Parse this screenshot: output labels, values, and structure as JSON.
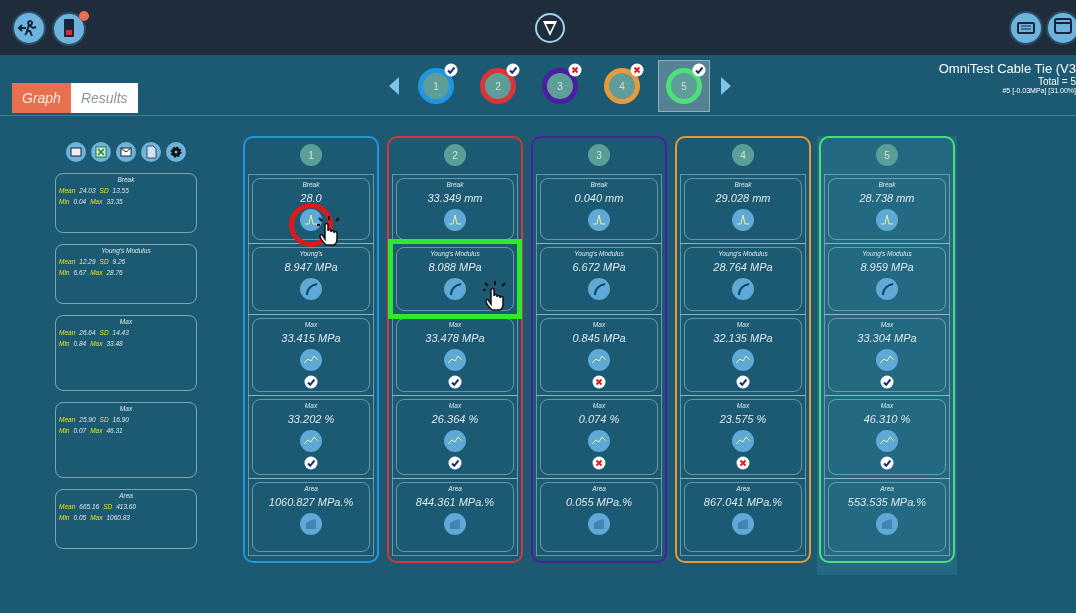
{
  "tabs": [
    {
      "label": "Graph",
      "selected": true
    },
    {
      "label": "Results",
      "selected": false
    }
  ],
  "specimens": [
    {
      "number": "1",
      "color": "#2196e0",
      "passed": true,
      "selected": false
    },
    {
      "number": "2",
      "color": "#d8343a",
      "passed": true,
      "selected": false
    },
    {
      "number": "3",
      "color": "#4a1fa0",
      "passed": false,
      "selected": false
    },
    {
      "number": "4",
      "color": "#e89a3a",
      "passed": false,
      "selected": false
    },
    {
      "number": "5",
      "color": "#4ddf7a",
      "passed": true,
      "selected": true
    }
  ],
  "test_info": {
    "title": "OmniTest Cable Tie (V3",
    "total": "Total = 5",
    "current": "#5 [-0.03MPa] [31.00%]"
  },
  "summary": [
    {
      "title": "Break",
      "mean_label": "Mean",
      "mean": "24.03",
      "sd_label": "SD",
      "sd": "13.55",
      "min_label": "Min",
      "min": "0.04",
      "max_label": "Max",
      "max": "33.35"
    },
    {
      "title": "Young's Modulus",
      "mean_label": "Mean",
      "mean": "12.29",
      "sd_label": "SD",
      "sd": "9.26",
      "min_label": "Min",
      "min": "6.67",
      "max_label": "Max",
      "max": "28.76"
    },
    {
      "title": "Max",
      "mean_label": "Mean",
      "mean": "26.64",
      "sd_label": "SD",
      "sd": "14.43",
      "min_label": "Min",
      "min": "0.84",
      "max_label": "Max",
      "max": "33.48"
    },
    {
      "title": "Max",
      "mean_label": "Mean",
      "mean": "25.90",
      "sd_label": "SD",
      "sd": "16.90",
      "min_label": "Min",
      "min": "0.07",
      "max_label": "Max",
      "max": "46.31"
    },
    {
      "title": "Area",
      "mean_label": "Mean",
      "mean": "665.16",
      "sd_label": "SD",
      "sd": "413.60",
      "min_label": "Min",
      "min": "0.05",
      "max_label": "Max",
      "max": "1060.83"
    }
  ],
  "columns": [
    {
      "number": "1",
      "color": "#2196e0",
      "selected": false,
      "cells": [
        {
          "kind": "break",
          "label": "Break",
          "value": "28.0",
          "circled": true
        },
        {
          "kind": "modulus",
          "label": "Young's",
          "value": "8.947 MPa"
        },
        {
          "kind": "max",
          "label": "Max",
          "value": "33.415 MPa",
          "passed": true
        },
        {
          "kind": "max",
          "label": "Max",
          "value": "33.202 %",
          "passed": true
        },
        {
          "kind": "area",
          "label": "Area",
          "value": "1060.827 MPa.%"
        }
      ]
    },
    {
      "number": "2",
      "color": "#d8343a",
      "selected": false,
      "cells": [
        {
          "kind": "break",
          "label": "Break",
          "value": "33.349 mm"
        },
        {
          "kind": "modulus",
          "label": "Young's Modulus",
          "value": "8.088 MPa",
          "boxed": true
        },
        {
          "kind": "max",
          "label": "Max",
          "value": "33.478 MPa",
          "passed": true
        },
        {
          "kind": "max",
          "label": "Max",
          "value": "26.364 %",
          "passed": true
        },
        {
          "kind": "area",
          "label": "Area",
          "value": "844.361 MPa.%"
        }
      ]
    },
    {
      "number": "3",
      "color": "#4a1fa0",
      "selected": false,
      "cells": [
        {
          "kind": "break",
          "label": "Break",
          "value": "0.040 mm"
        },
        {
          "kind": "modulus",
          "label": "Young's Modulus",
          "value": "6.672 MPa"
        },
        {
          "kind": "max",
          "label": "Max",
          "value": "0.845 MPa",
          "passed": false
        },
        {
          "kind": "max",
          "label": "Max",
          "value": "0.074 %",
          "passed": false
        },
        {
          "kind": "area",
          "label": "Area",
          "value": "0.055 MPa.%"
        }
      ]
    },
    {
      "number": "4",
      "color": "#e89a3a",
      "selected": false,
      "cells": [
        {
          "kind": "break",
          "label": "Break",
          "value": "29.028 mm"
        },
        {
          "kind": "modulus",
          "label": "Young's Modulus",
          "value": "28.764 MPa"
        },
        {
          "kind": "max",
          "label": "Max",
          "value": "32.135 MPa",
          "passed": true
        },
        {
          "kind": "max",
          "label": "Max",
          "value": "23.575 %",
          "passed": false
        },
        {
          "kind": "area",
          "label": "Area",
          "value": "867.041 MPa.%"
        }
      ]
    },
    {
      "number": "5",
      "color": "#4ddf7a",
      "selected": true,
      "cells": [
        {
          "kind": "break",
          "label": "Break",
          "value": "28.738 mm"
        },
        {
          "kind": "modulus",
          "label": "Young's Modulus",
          "value": "8.959 MPa"
        },
        {
          "kind": "max",
          "label": "Max",
          "value": "33.304 MPa",
          "passed": true
        },
        {
          "kind": "max",
          "label": "Max",
          "value": "46.310 %",
          "passed": true
        },
        {
          "kind": "area",
          "label": "Area",
          "value": "553.535 MPa.%"
        }
      ]
    }
  ]
}
